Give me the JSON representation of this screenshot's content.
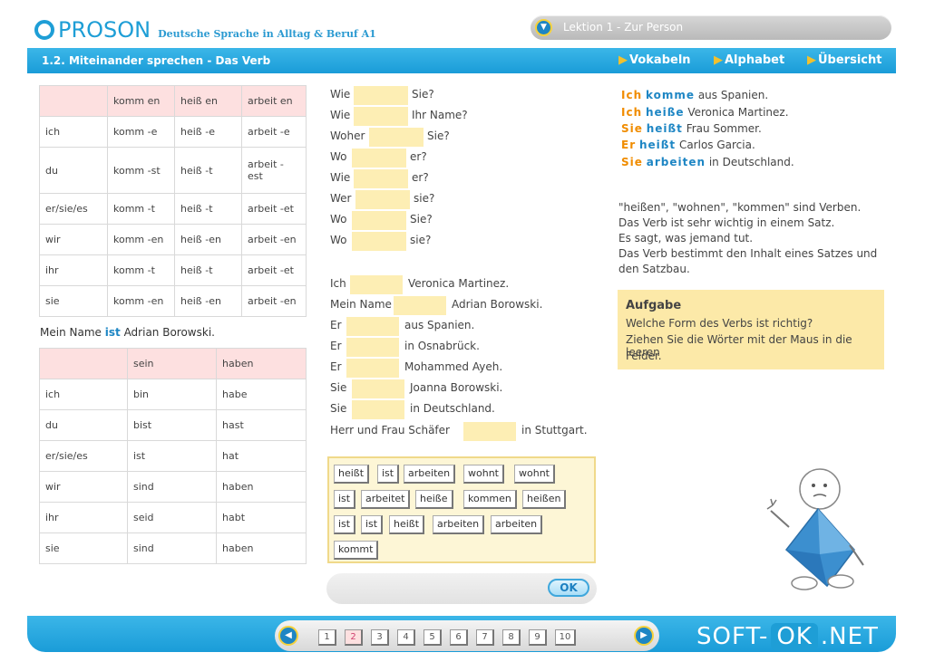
{
  "header": {
    "logo_text": "PROSON",
    "subtitle": "Deutsche Sprache in Alltag & Beruf A1",
    "lesson": "Lektion 1 - Zur Person"
  },
  "toolbar": {
    "section_title": "1.2. Miteinander sprechen - Das Verb",
    "nav": [
      "Vokabeln",
      "Alphabet",
      "Übersicht"
    ]
  },
  "table1": {
    "header": [
      "",
      "komm en",
      "heiß en",
      "arbeit en"
    ],
    "rows": [
      [
        "ich",
        "komm -e",
        "heiß -e",
        "arbeit -e"
      ],
      [
        "du",
        "komm -st",
        "heiß -t",
        "arbeit - est"
      ],
      [
        "er/sie/es",
        "komm -t",
        "heiß -t",
        "arbeit -et"
      ],
      [
        "wir",
        "komm -en",
        "heiß -en",
        "arbeit -en"
      ],
      [
        "ihr",
        "komm -t",
        "heiß -t",
        "arbeit -et"
      ],
      [
        "sie",
        "komm -en",
        "heiß -en",
        "arbeit -en"
      ]
    ]
  },
  "example_sentence": {
    "before": "Mein Name",
    "verb": "ist",
    "after": "Adrian Borowski."
  },
  "table2": {
    "header": [
      "",
      "sein",
      "haben"
    ],
    "rows": [
      [
        "ich",
        "bin",
        "habe"
      ],
      [
        "du",
        "bist",
        "hast"
      ],
      [
        "er/sie/es",
        "ist",
        "hat"
      ],
      [
        "wir",
        "sind",
        "haben"
      ],
      [
        "ihr",
        "seid",
        "habt"
      ],
      [
        "sie",
        "sind",
        "haben"
      ]
    ]
  },
  "questions": [
    {
      "a": "Wie",
      "b": "Sie?"
    },
    {
      "a": "Wie",
      "b": "Ihr Name?"
    },
    {
      "a": "Woher",
      "b": "Sie?"
    },
    {
      "a": "Wo",
      "b": "er?"
    },
    {
      "a": "Wie",
      "b": "er?"
    },
    {
      "a": "Wer",
      "b": "sie?"
    },
    {
      "a": "Wo",
      "b": "Sie?"
    },
    {
      "a": "Wo",
      "b": "sie?"
    }
  ],
  "statements": [
    {
      "a": "Ich",
      "b": "Veronica  Martinez."
    },
    {
      "a": "Mein  Name",
      "b": "Adrian  Borowski."
    },
    {
      "a": "Er",
      "b": "aus  Spanien."
    },
    {
      "a": "Er",
      "b": "in  Osnabrück."
    },
    {
      "a": "Er",
      "b": "Mohammed  Ayeh."
    },
    {
      "a": "Sie",
      "b": "Joanna  Borowski."
    },
    {
      "a": "Sie",
      "b": "in  Deutschland."
    },
    {
      "a": "Herr  und  Frau  Schäfer",
      "b": "in  Stuttgart."
    }
  ],
  "word_bank": [
    [
      "heißt",
      "ist",
      "arbeiten",
      "wohnt",
      "wohnt"
    ],
    [
      "ist",
      "arbeitet",
      "heiße",
      "kommen",
      "heißen"
    ],
    [
      "ist",
      "ist",
      "heißt",
      "arbeiten",
      "arbeiten"
    ],
    [
      "kommt"
    ]
  ],
  "ok_label": "OK",
  "examples": [
    {
      "p": "Ich",
      "v": "komme",
      "rest": " aus Spanien."
    },
    {
      "p": "Ich",
      "v": "heiße",
      "rest": " Veronica Martinez."
    },
    {
      "p": "Sie",
      "v": "heißt",
      "rest": " Frau Sommer."
    },
    {
      "p": "Er",
      "v": "heißt",
      "rest": " Carlos Garcia."
    },
    {
      "p": "Sie",
      "v": "arbeiten",
      "rest": " in Deutschland."
    }
  ],
  "explanation": [
    "\"heißen\", \"wohnen\", \"kommen\" sind Verben.",
    "Das Verb ist sehr wichtig in einem Satz.",
    "Es sagt, was jemand tut.",
    "Das Verb bestimmt den Inhalt eines Satzes und",
    "den Satzbau."
  ],
  "task": {
    "title": "Aufgabe",
    "lines": [
      "Welche Form des Verbs ist richtig?",
      "Ziehen Sie die Wörter mit der Maus in die leeren",
      "Felder."
    ]
  },
  "pager": {
    "pages": [
      "1",
      "2",
      "3",
      "4",
      "5",
      "6",
      "7",
      "8",
      "9",
      "10"
    ],
    "current": "2"
  },
  "watermark": {
    "a": "SOFT-",
    "b": "OK",
    "c": ".NET"
  }
}
